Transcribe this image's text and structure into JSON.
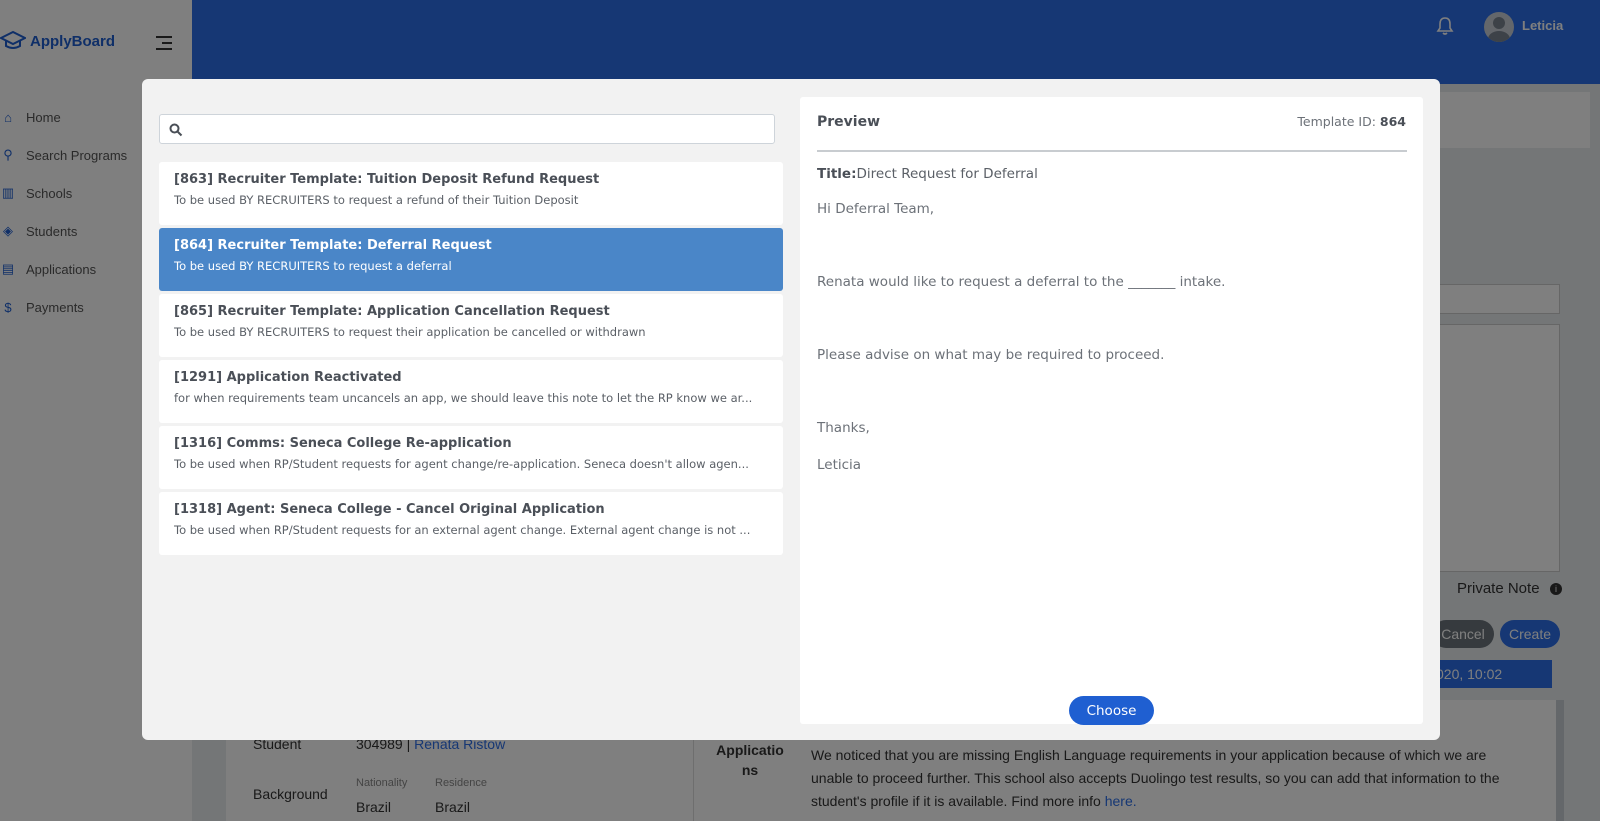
{
  "app": {
    "brand": "ApplyBoard",
    "user_name": "Leticia",
    "sidebar_items": [
      {
        "label": "Home",
        "icon": "home-icon"
      },
      {
        "label": "Search Programs",
        "icon": "search-icon"
      },
      {
        "label": "Schools",
        "icon": "school-icon"
      },
      {
        "label": "Students",
        "icon": "students-icon"
      },
      {
        "label": "Applications",
        "icon": "document-icon"
      },
      {
        "label": "Payments",
        "icon": "dollar-icon"
      }
    ],
    "background": {
      "private_note_label": "Private Note",
      "cancel_label": "Cancel",
      "create_label": "Create",
      "date_text": "020, 10:02",
      "student_label": "Student",
      "student_value": "304989",
      "student_link": "Renata Ristow",
      "background_label": "Background",
      "nationality_label": "Nationality",
      "nationality_value": "Brazil",
      "residence_label": "Residence",
      "residence_value": "Brazil",
      "applications_label": "Applications",
      "message_text": "We noticed that you are missing English Language requirements in your application because of which we are unable to proceed further. This school also accepts Duolingo test results, so you can add that information to the student's profile if it is available. Find more info",
      "message_link": "here."
    }
  },
  "modal": {
    "search": {
      "value": "",
      "placeholder": ""
    },
    "templates": [
      {
        "title": "[863] Recruiter Template: Tuition Deposit Refund Request",
        "description": "To be used BY RECRUITERS to request a refund of their Tuition Deposit",
        "selected": false
      },
      {
        "title": "[864] Recruiter Template: Deferral Request",
        "description": "To be used BY RECRUITERS to request a deferral",
        "selected": true
      },
      {
        "title": "[865] Recruiter Template: Application Cancellation Request",
        "description": "To be used BY RECRUITERS to request their application be cancelled or withdrawn",
        "selected": false
      },
      {
        "title": "[1291] Application Reactivated",
        "description": "for when requirements team uncancels an app, we should leave this note to let the RP know we ar...",
        "selected": false
      },
      {
        "title": "[1316] Comms: Seneca College Re-application",
        "description": "To be used when RP/Student requests for agent change/re-application. Seneca doesn't allow agen...",
        "selected": false
      },
      {
        "title": "[1318] Agent: Seneca College - Cancel Original Application",
        "description": "To be used when RP/Student requests for an external agent change. External agent change is not ...",
        "selected": false
      }
    ],
    "preview": {
      "heading": "Preview",
      "template_id_label": "Template ID:",
      "template_id_value": "864",
      "title_label": "Title:",
      "title_value": "Direct Request for Deferral",
      "body_lines": [
        "Hi Deferral Team,",
        "Renata would like to request a deferral to the _______ intake.",
        "Please advise on what may be required to proceed.",
        "Thanks,",
        "Leticia"
      ],
      "choose_label": "Choose"
    }
  },
  "colors": {
    "brand_blue": "#1f5fd1",
    "topbar_blue": "#2d6fe8",
    "selected_item": "#4a86c8",
    "overlay": "rgba(0,0,0,0.5)"
  }
}
